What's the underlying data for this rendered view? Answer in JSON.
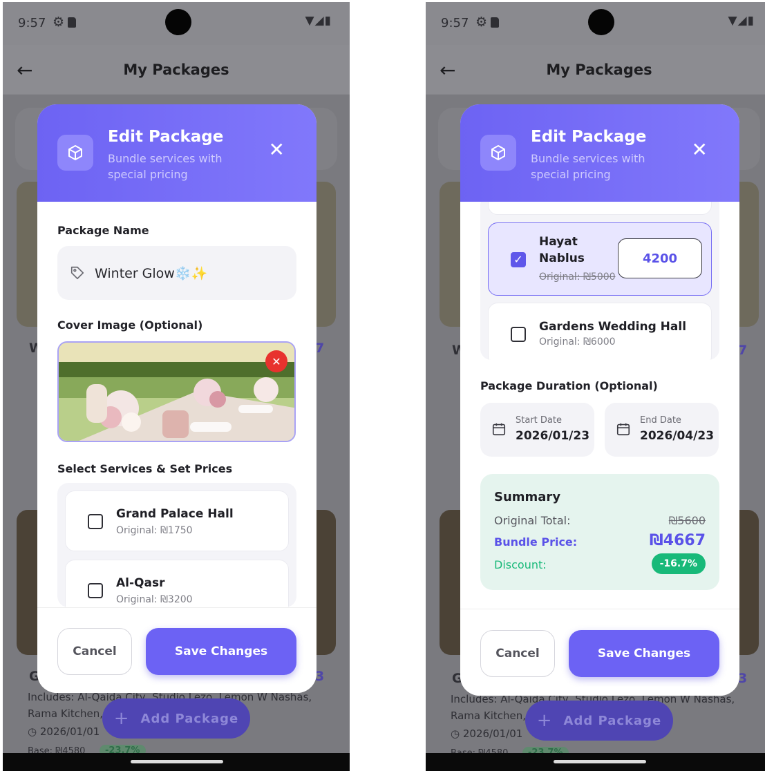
{
  "status": {
    "time": "9:57"
  },
  "appbar": {
    "title": "My Packages"
  },
  "modal": {
    "title": "Edit Package",
    "subtitle": "Bundle services with special pricing",
    "package_name_label": "Package Name",
    "package_name_value": "Winter Glow❄️✨",
    "cover_image_label": "Cover Image (Optional)",
    "services_label": "Select Services & Set Prices",
    "services": [
      {
        "name": "Grand Palace Hall",
        "original": "Original: ₪1750",
        "checked": false
      },
      {
        "name": "Al-Qasr",
        "original": "Original: ₪3200",
        "checked": false
      },
      {
        "name": "Hayat Nablus",
        "original": "Original: ₪5000",
        "checked": true,
        "price": "4200"
      },
      {
        "name": "Gardens Wedding Hall",
        "original": "Original: ₪6000",
        "checked": false
      }
    ],
    "duration_label": "Package Duration (Optional)",
    "start_date_label": "Start Date",
    "start_date_value": "2026/01/23",
    "end_date_label": "End Date",
    "end_date_value": "2026/04/23",
    "summary": {
      "title": "Summary",
      "original_total_label": "Original Total:",
      "original_total_value": "₪5600",
      "bundle_price_label": "Bundle Price:",
      "bundle_price_value": "₪4667",
      "discount_label": "Discount:",
      "discount_value": "-16.7%"
    },
    "cancel_label": "Cancel",
    "save_label": "Save Changes"
  },
  "background": {
    "card_letter_1": "W",
    "card_letter_2": "G",
    "card2_includes": "Includes: Al-Qaida City, Studio Lezo, Lemon W Nashas,",
    "card2_rama": "Rama Kitchen, ",
    "card2_date": "2026/01/01",
    "card2_base": "Base: ₪4580",
    "card2_badge": "-23.7%",
    "price_digit_1": "7",
    "price_digit_2": "3",
    "add_package_label": "Add Package"
  },
  "colors": {
    "accent": "#6c62f4",
    "header_gradient_start": "#6d63f3",
    "header_gradient_end": "#8178fb",
    "discount_green": "#18b979",
    "summary_bg": "#e5f4ee"
  },
  "icons": [
    "back-arrow-icon",
    "package-icon",
    "close-icon",
    "tag-icon",
    "checkbox-icon",
    "calendar-icon",
    "remove-image-icon",
    "plus-icon"
  ]
}
